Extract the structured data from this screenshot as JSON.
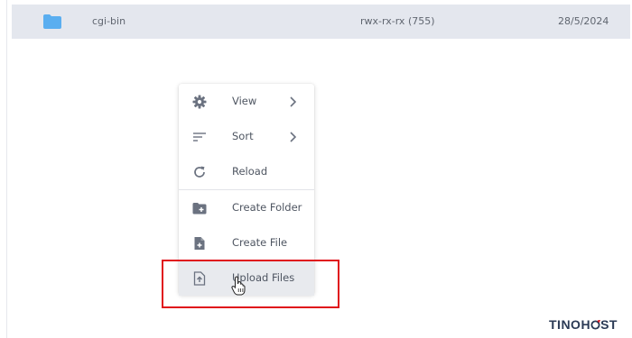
{
  "file_row": {
    "name": "cgi-bin",
    "permissions": "rwx-rx-rx (755)",
    "date": "28/5/2024",
    "icon": "folder-icon",
    "icon_color": "#5aaef0"
  },
  "context_menu": {
    "items": [
      {
        "label": "View",
        "icon": "gear-icon",
        "has_submenu": true
      },
      {
        "label": "Sort",
        "icon": "sort-lines-icon",
        "has_submenu": true
      },
      {
        "label": "Reload",
        "icon": "reload-icon",
        "has_submenu": false
      },
      {
        "label": "Create Folder",
        "icon": "folder-plus-icon",
        "has_submenu": false
      },
      {
        "label": "Create File",
        "icon": "file-plus-icon",
        "has_submenu": false
      },
      {
        "label": "Upload Files",
        "icon": "file-upload-icon",
        "has_submenu": false,
        "hovered": true
      }
    ]
  },
  "annotation": {
    "highlight_color": "#e0121b"
  },
  "brand": {
    "text_a": "TINO",
    "text_b": "H",
    "text_c": "ST",
    "color": "#2b3a55"
  }
}
